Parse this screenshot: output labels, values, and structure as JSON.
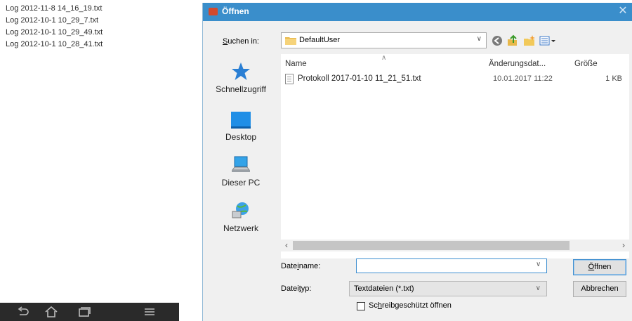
{
  "phone": {
    "log_files": [
      "Log 2012-11-8 14_16_19.txt",
      "Log 2012-10-1 10_29_7.txt",
      "Log 2012-10-1 10_29_49.txt",
      "Log 2012-10-1 10_28_41.txt"
    ],
    "nav_icons": [
      "back-icon",
      "home-icon",
      "recents-icon",
      "menu-icon"
    ]
  },
  "dialog": {
    "title": "Öffnen",
    "close_glyph": "✕",
    "lookin_label": {
      "pre": "",
      "key": "S",
      "post": "uchen in:"
    },
    "lookin_value": "DefaultUser",
    "toolbar_icons": [
      "back-icon",
      "up-folder-icon",
      "new-folder-icon",
      "view-menu-icon"
    ],
    "places": [
      {
        "label": "Schnellzugriff",
        "icon": "quick-access-icon"
      },
      {
        "label": "Desktop",
        "icon": "desktop-icon"
      },
      {
        "label": "Dieser PC",
        "icon": "this-pc-icon"
      },
      {
        "label": "Netzwerk",
        "icon": "network-icon"
      }
    ],
    "columns": {
      "name": "Name",
      "date": "Änderungsdat...",
      "size": "Größe"
    },
    "files": [
      {
        "name": "Protokoll 2017-01-10 11_21_51.txt",
        "date": "10.01.2017 11:22",
        "size": "1 KB"
      }
    ],
    "filename_label": {
      "pre": "Date",
      "key": "i",
      "post": "name:"
    },
    "filename_value": "",
    "filetype_label": {
      "pre": "Datei",
      "key": "t",
      "post": "yp:"
    },
    "filetype_value": "Textdateien (*.txt)",
    "open_button": {
      "pre": "",
      "key": "Ö",
      "post": "ffnen"
    },
    "cancel_button": "Abbrechen",
    "readonly_label": {
      "pre": "Sc",
      "key": "h",
      "post": "reibgeschützt öffnen"
    },
    "readonly_checked": false
  }
}
